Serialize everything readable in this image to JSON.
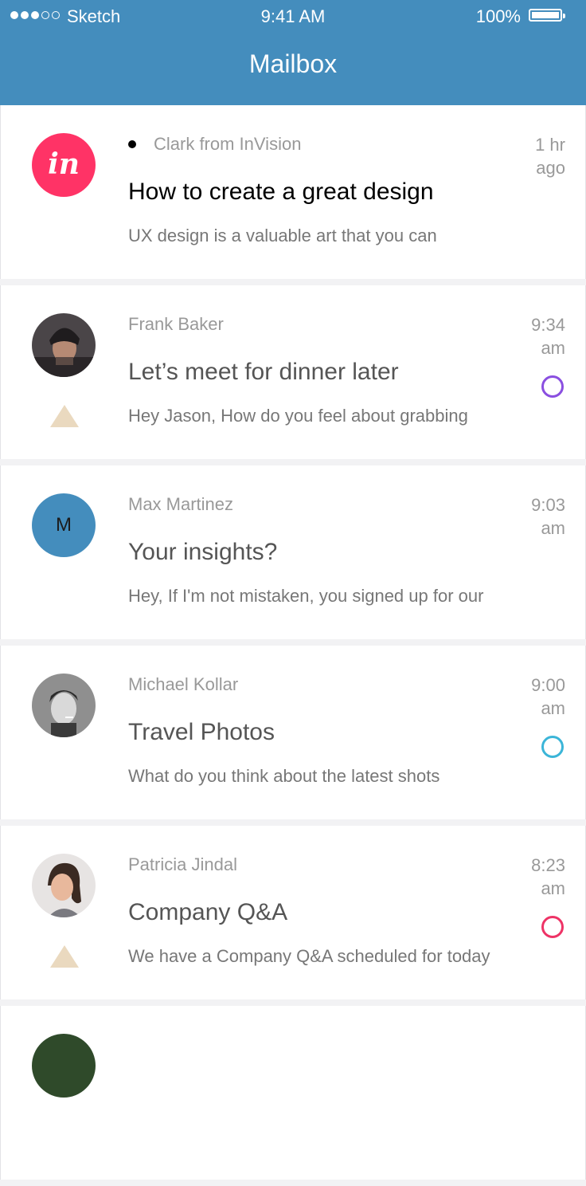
{
  "status_bar": {
    "carrier": "Sketch",
    "time": "9:41 AM",
    "battery_pct": "100%",
    "signal_filled": 3,
    "signal_total": 5
  },
  "header": {
    "title": "Mailbox",
    "color": "#448dbd"
  },
  "messages": [
    {
      "sender": "Clark from InVision",
      "subject": "How to create a great design",
      "preview": "UX design is a valuable art that you can",
      "time": "1 hr ago",
      "time_line1": "1 hr",
      "time_line2": "ago",
      "unread": true,
      "avatar": "invision-logo",
      "avatar_text": "in"
    },
    {
      "sender": "Frank Baker",
      "subject": "Let’s meet for dinner later",
      "preview": "Hey Jason, How do you feel about grabbing",
      "time_line1": "9:34",
      "time_line2": "am",
      "avatar": "photo-frank-baker",
      "flag": true,
      "ring_color": "#8a4fe0"
    },
    {
      "sender": "Max Martinez",
      "subject": "Your insights?",
      "preview": "Hey, If I'm not mistaken, you signed up for our",
      "time_line1": "9:03",
      "time_line2": "am",
      "avatar": "letter",
      "avatar_text": "M"
    },
    {
      "sender": "Michael Kollar",
      "subject": "Travel Photos",
      "preview": "What do you think about the latest shots",
      "time_line1": "9:00",
      "time_line2": "am",
      "avatar": "photo-michael-kollar",
      "ring_color": "#3bb5d8"
    },
    {
      "sender": "Patricia Jindal",
      "subject": "Company Q&A",
      "preview": "We have a Company Q&A scheduled for today",
      "time_line1": "8:23",
      "time_line2": "am",
      "avatar": "photo-patricia-jindal",
      "flag": true,
      "ring_color": "#ee3366"
    }
  ]
}
